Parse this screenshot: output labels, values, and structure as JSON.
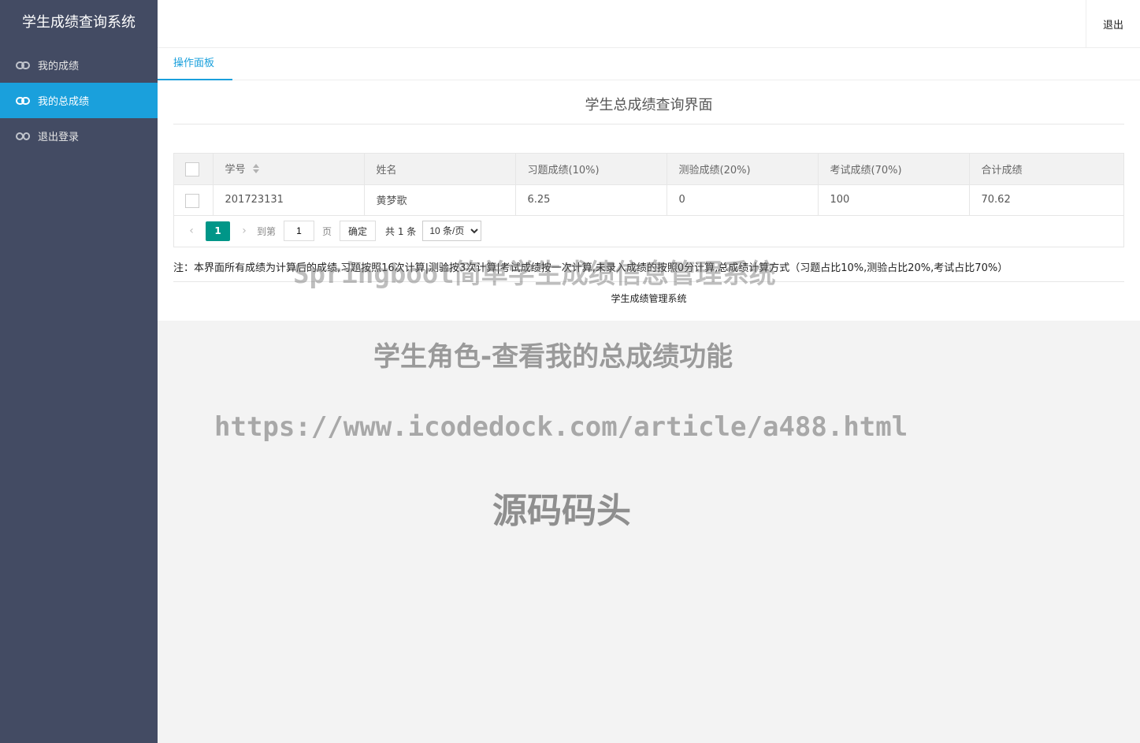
{
  "app": {
    "title": "学生成绩查询系统"
  },
  "sidebar": {
    "items": [
      {
        "label": "我的成绩",
        "icon": "link-icon",
        "active": false
      },
      {
        "label": "我的总成绩",
        "icon": "link-icon",
        "active": true
      },
      {
        "label": "退出登录",
        "icon": "unlink-icon",
        "active": false
      }
    ]
  },
  "header": {
    "logout_label": "退出"
  },
  "tabs": [
    {
      "label": "操作面板"
    }
  ],
  "page": {
    "title": "学生总成绩查询界面"
  },
  "table": {
    "columns": [
      "学号",
      "姓名",
      "习题成绩(10%)",
      "测验成绩(20%)",
      "考试成绩(70%)",
      "合计成绩"
    ],
    "rows": [
      [
        "201723131",
        "黄梦歌",
        "6.25",
        "0",
        "100",
        "70.62"
      ]
    ]
  },
  "pager": {
    "current_page": "1",
    "goto_label": "到第",
    "page_input": "1",
    "page_unit": "页",
    "confirm_label": "确定",
    "total_label": "共 1 条",
    "page_size": "10 条/页",
    "prev_icon": "chevron-left-icon",
    "next_icon": "chevron-right-icon"
  },
  "note": "注：本界面所有成绩为计算后的成绩,习题按照16次计算|测验按3次计算|考试成绩按一次计算,未录入成绩的按照0分计算,总成绩计算方式（习题占比10%,测验占比20%,考试占比70%）",
  "footer": "学生成绩管理系统",
  "watermarks": {
    "line1": "Springboot简单学生成绩信息管理系统",
    "line2": "学生角色-查看我的总成绩功能",
    "line3": "https://www.icodedock.com/article/a488.html",
    "line4": "源码码头"
  },
  "colors": {
    "sidebar_bg": "#434b63",
    "accent": "#1aa0dc",
    "pager_current": "#009688"
  }
}
